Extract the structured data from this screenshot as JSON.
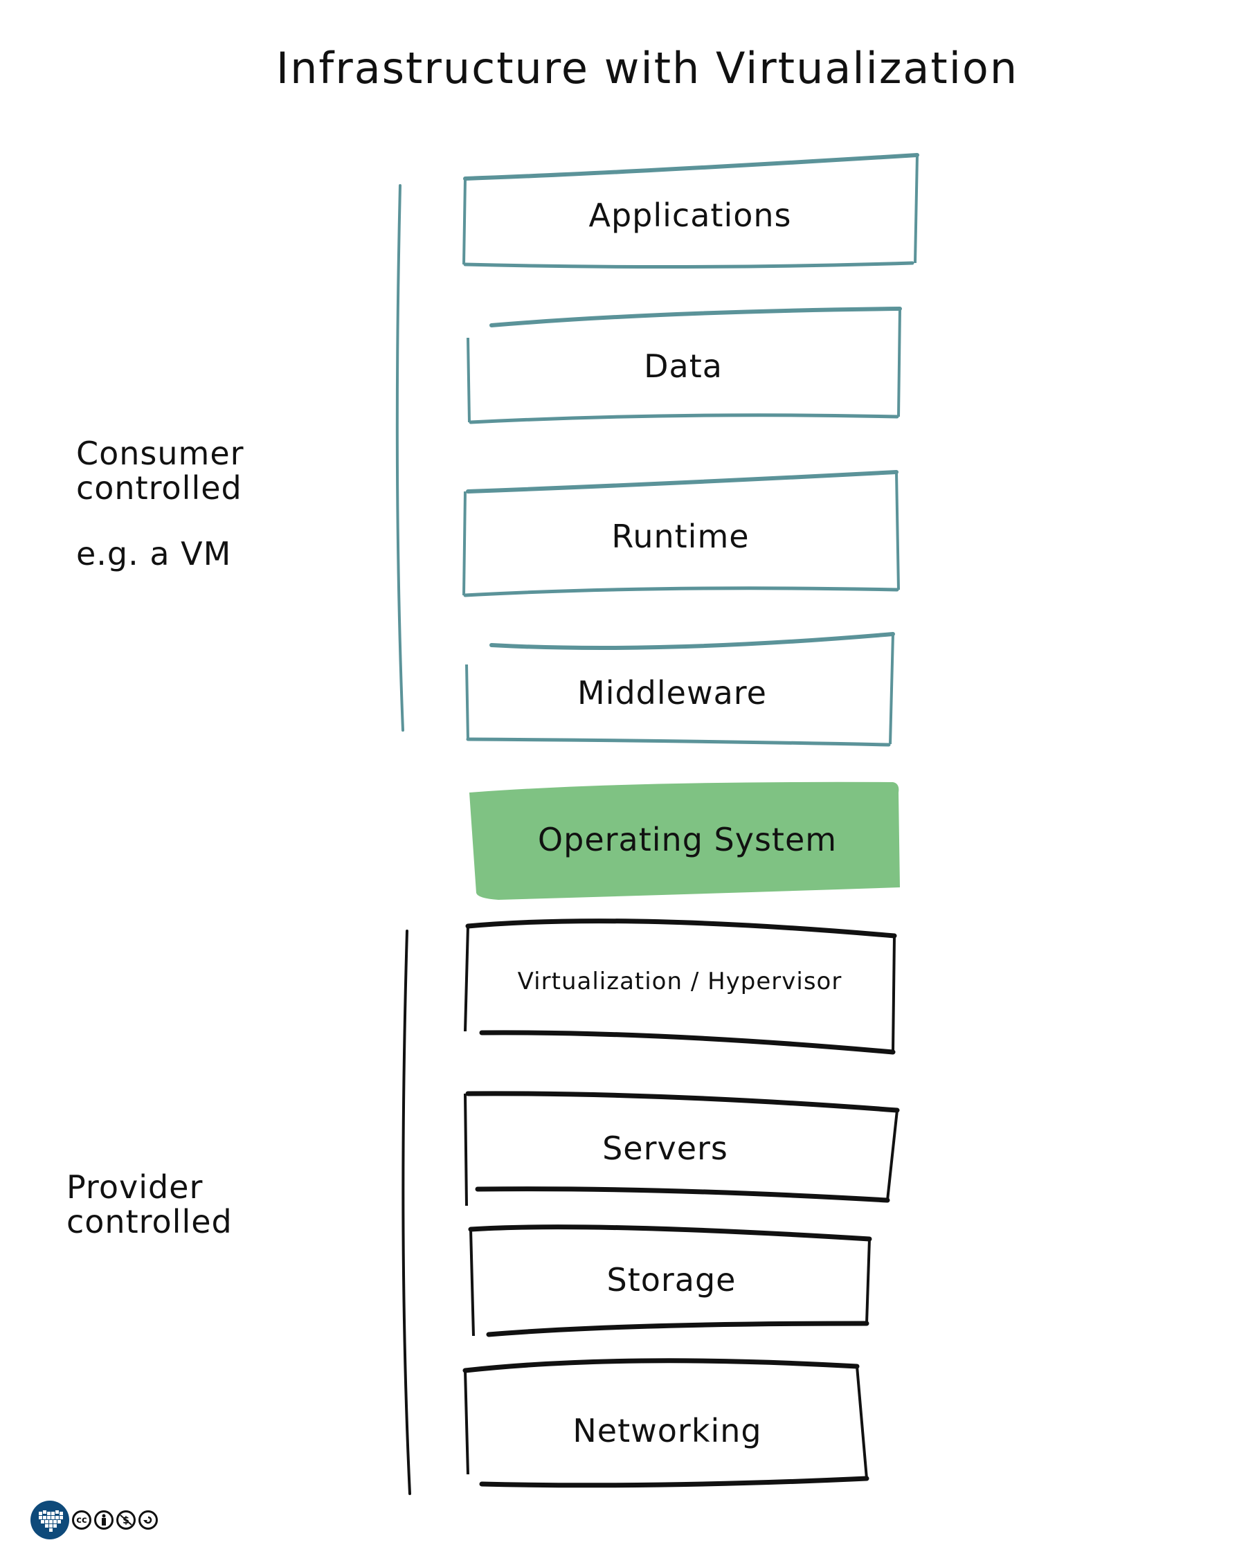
{
  "title": "Infrastructure with Virtualization",
  "colors": {
    "consumer_stroke": "#5b9399",
    "provider_stroke": "#111111",
    "os_fill": "#7fc283",
    "license_blue": "#0e4a7a"
  },
  "groups": {
    "consumer": {
      "label_line1": "Consumer",
      "label_line2": "controlled",
      "example": "e.g. a VM"
    },
    "provider": {
      "label_line1": "Provider",
      "label_line2": "controlled"
    }
  },
  "layers": [
    {
      "label": "Applications",
      "group": "consumer"
    },
    {
      "label": "Data",
      "group": "consumer"
    },
    {
      "label": "Runtime",
      "group": "consumer"
    },
    {
      "label": "Middleware",
      "group": "consumer"
    },
    {
      "label": "Operating System",
      "group": "highlight"
    },
    {
      "label": "Virtualization / Hypervisor",
      "group": "provider"
    },
    {
      "label": "Servers",
      "group": "provider"
    },
    {
      "label": "Storage",
      "group": "provider"
    },
    {
      "label": "Networking",
      "group": "provider"
    }
  ],
  "license": {
    "icons": [
      "cc-icon",
      "by-icon",
      "nc-icon",
      "sa-icon"
    ],
    "cc_text": "cc"
  }
}
